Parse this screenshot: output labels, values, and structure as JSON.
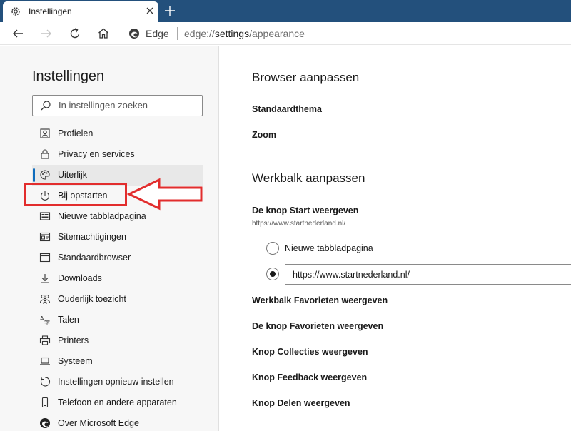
{
  "tab": {
    "title": "Instellingen"
  },
  "address_bar": {
    "brand": "Edge",
    "url_prefix": "edge://",
    "url_highlight": "settings",
    "url_suffix": "/appearance"
  },
  "sidebar": {
    "title": "Instellingen",
    "search_placeholder": "In instellingen zoeken",
    "items": [
      {
        "label": "Profielen",
        "icon": "profile-icon"
      },
      {
        "label": "Privacy en services",
        "icon": "lock-icon"
      },
      {
        "label": "Uiterlijk",
        "icon": "palette-icon",
        "active": true
      },
      {
        "label": "Bij opstarten",
        "icon": "power-icon"
      },
      {
        "label": "Nieuwe tabbladpagina",
        "icon": "new-tab-page-icon"
      },
      {
        "label": "Sitemachtigingen",
        "icon": "site-permissions-icon"
      },
      {
        "label": "Standaardbrowser",
        "icon": "default-browser-icon"
      },
      {
        "label": "Downloads",
        "icon": "download-icon"
      },
      {
        "label": "Ouderlijk toezicht",
        "icon": "family-icon"
      },
      {
        "label": "Talen",
        "icon": "languages-icon"
      },
      {
        "label": "Printers",
        "icon": "printer-icon"
      },
      {
        "label": "Systeem",
        "icon": "laptop-icon"
      },
      {
        "label": "Instellingen opnieuw instellen",
        "icon": "reset-icon"
      },
      {
        "label": "Telefoon en andere apparaten",
        "icon": "phone-icon"
      },
      {
        "label": "Over Microsoft Edge",
        "icon": "edge-logo-icon"
      }
    ]
  },
  "main": {
    "section1_title": "Browser aanpassen",
    "standard_theme": "Standaardthema",
    "zoom": "Zoom",
    "section2_title": "Werkbalk aanpassen",
    "start_button": "De knop Start weergeven",
    "start_url": "https://www.startnederland.nl/",
    "radio_new_tab": "Nieuwe tabbladpagina",
    "radio_url_value": "https://www.startnederland.nl/",
    "favorites_bar": "Werkbalk Favorieten weergeven",
    "favorites_button": "De knop Favorieten weergeven",
    "collections_button": "Knop Collecties weergeven",
    "feedback_button": "Knop Feedback weergeven",
    "share_button": "Knop Delen weergeven"
  },
  "colors": {
    "tabstrip": "#23507c",
    "annotation": "#e22d2d",
    "accent": "#0f6cbd"
  }
}
